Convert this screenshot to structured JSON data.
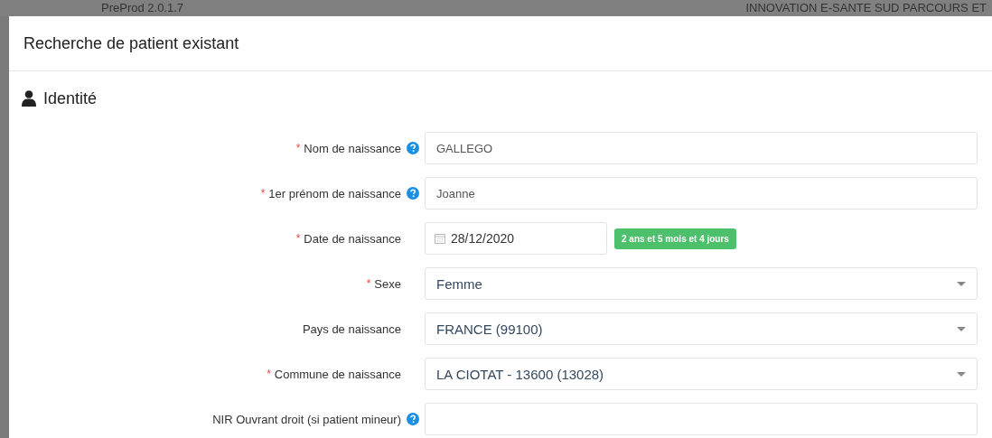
{
  "background": {
    "app_title": "PreProd 2.0.1.7",
    "organization": "INNOVATION E-SANTE SUD PARCOURS ET"
  },
  "dialog": {
    "title": "Recherche de patient existant"
  },
  "section": {
    "title": "Identité"
  },
  "fields": [
    {
      "kind": "text",
      "label": "Nom de naissance",
      "required_mark": "*",
      "help": true,
      "value": "GALLEGO"
    },
    {
      "kind": "text",
      "label": "1er prénom de naissance",
      "required_mark": "*",
      "help": true,
      "value": "Joanne"
    },
    {
      "kind": "date",
      "label": "Date de naissance",
      "required_mark": "*",
      "help": false,
      "value": "28/12/2020",
      "badge": "2 ans et 5 mois et 4 jours"
    },
    {
      "kind": "select",
      "label": "Sexe",
      "required_mark": "*",
      "help": false,
      "value": "Femme"
    },
    {
      "kind": "select",
      "label": "Pays de naissance",
      "help": false,
      "value": "FRANCE (99100)"
    },
    {
      "kind": "select",
      "label": "Commune de naissance",
      "required_mark": "*",
      "help": false,
      "value": "LA CIOTAT - 13600 (13028)"
    },
    {
      "kind": "text",
      "label": "NIR Ouvrant droit (si patient mineur)",
      "help": true
    }
  ]
}
